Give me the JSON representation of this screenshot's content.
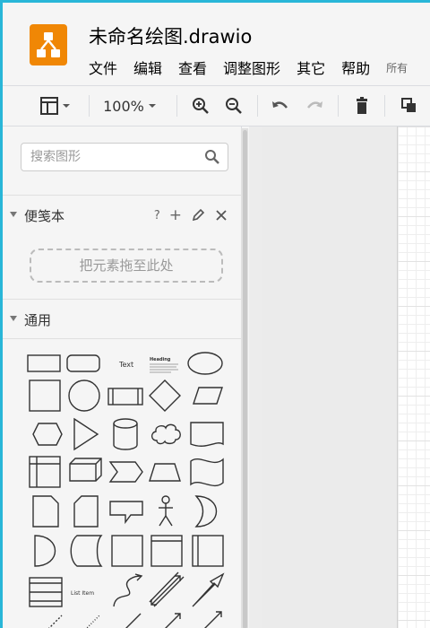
{
  "app": {
    "title": "未命名绘图.drawio",
    "menus": [
      "文件",
      "编辑",
      "查看",
      "调整图形",
      "其它",
      "帮助"
    ],
    "menu_extra": "所有",
    "brand_color": "#f08705",
    "frame_color": "#29b6d8"
  },
  "toolbar": {
    "zoom": "100%",
    "icons": [
      "format-panel-icon",
      "zoom-in-icon",
      "zoom-out-icon",
      "undo-icon",
      "redo-icon",
      "delete-icon",
      "to-front-icon"
    ]
  },
  "sidebar": {
    "search_placeholder": "搜索图形",
    "scratchpad": {
      "title": "便笺本",
      "help": "?",
      "add": "+",
      "drop_text": "把元素拖至此处"
    },
    "general": {
      "title": "通用",
      "text_shape_label": "Text",
      "heading_shape_label": "Heading",
      "list_item_label": "List Item"
    }
  }
}
